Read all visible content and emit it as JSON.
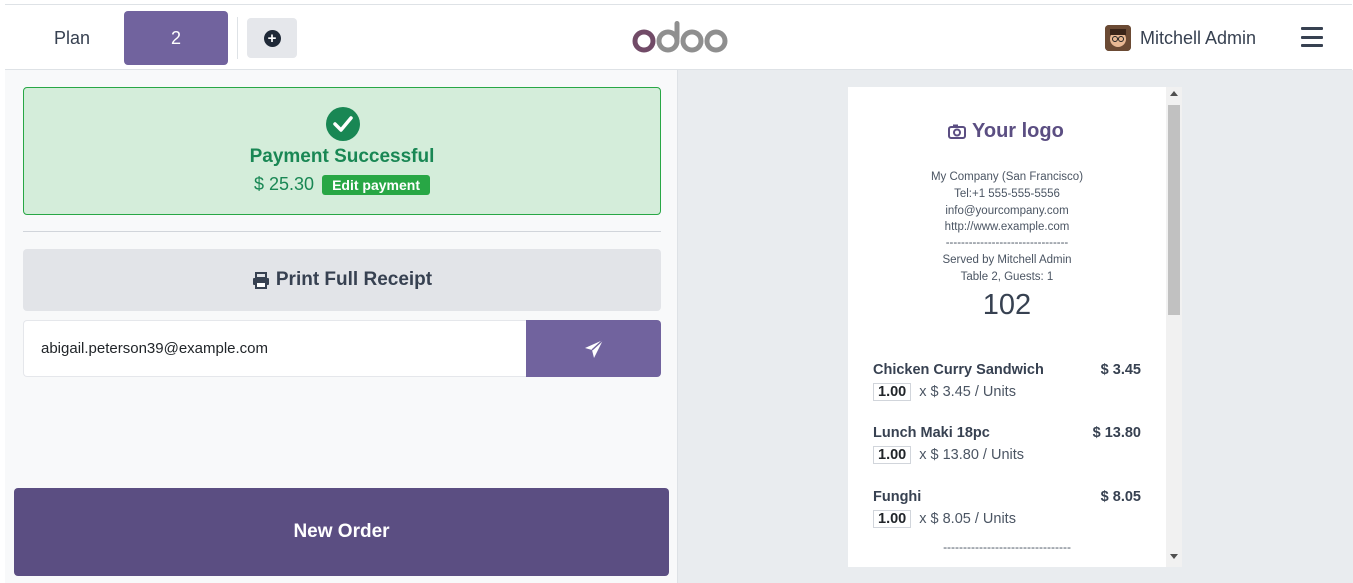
{
  "header": {
    "plan_label": "Plan",
    "table_label": "2",
    "add_icon": "plus-circle-icon",
    "logo_text": "odoo",
    "user_name": "Mitchell Admin",
    "menu_icon": "hamburger-icon"
  },
  "payment": {
    "title": "Payment Successful",
    "amount": "$ 25.30",
    "edit_label": "Edit payment",
    "status_color": "#198754"
  },
  "actions": {
    "print_label": "Print Full Receipt",
    "email_value": "abigail.peterson39@example.com",
    "send_icon": "paper-plane-icon",
    "new_order_label": "New Order"
  },
  "receipt": {
    "logo_text": "Your logo",
    "company": "My Company (San Francisco)",
    "phone": "Tel:+1 555-555-5556",
    "email": "info@yourcompany.com",
    "website": "http://www.example.com",
    "dashes": "--------------------------------",
    "served_by": "Served by Mitchell Admin",
    "table_guests": "Table 2, Guests: 1",
    "order_number": "102",
    "items": [
      {
        "name": "Chicken Curry Sandwich",
        "price": "$ 3.45",
        "qty": "1.00",
        "unit": "x $ 3.45 / Units"
      },
      {
        "name": "Lunch Maki 18pc",
        "price": "$ 13.80",
        "qty": "1.00",
        "unit": "x $ 13.80 / Units"
      },
      {
        "name": "Funghi",
        "price": "$ 8.05",
        "qty": "1.00",
        "unit": "x $ 8.05 / Units"
      }
    ],
    "dashes2": "--------------------------------"
  },
  "colors": {
    "accent": "#71639e",
    "new_order": "#5b4e82",
    "success_bg": "#d4edda"
  }
}
